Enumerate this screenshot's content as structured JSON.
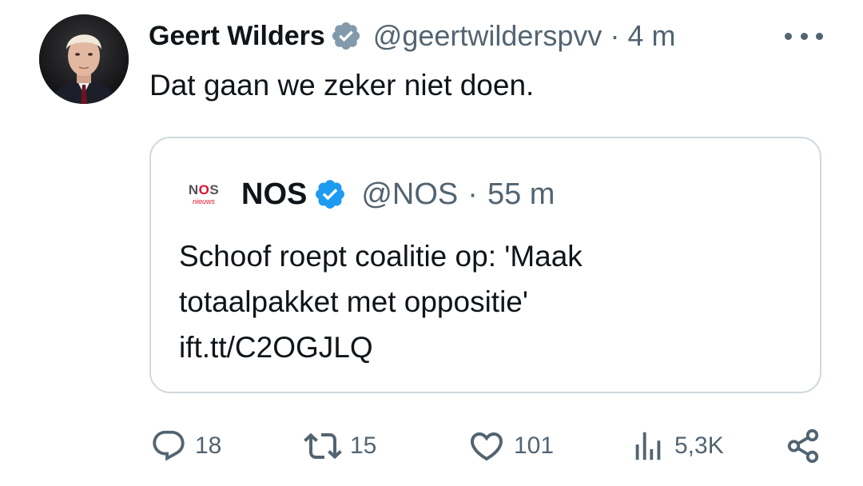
{
  "tweet": {
    "author": {
      "name": "Geert Wilders",
      "handle": "@geertwilderspvv",
      "verified_badge_color": "#829aab",
      "avatar_icon": "profile-photo"
    },
    "separator": "·",
    "time": "4 m",
    "more_icon": "ellipsis-icon",
    "text": "Dat gaan we zeker niet doen."
  },
  "quoted": {
    "logo_text": "NOS",
    "logo_subtext": "nieuws",
    "name": "NOS",
    "handle": "@NOS",
    "separator": "·",
    "time": "55 m",
    "verified_badge_color": "#1d9bf0",
    "text_lines": [
      "Schoof roept coalitie op: 'Maak",
      "totaalpakket met oppositie'",
      "ift.tt/C2OGJLQ"
    ]
  },
  "actions": {
    "replies": "18",
    "reposts": "15",
    "likes": "101",
    "views": "5,3K",
    "icons": [
      "reply-icon",
      "repost-icon",
      "like-icon",
      "views-icon",
      "share-icon"
    ],
    "icon_color": "#536471"
  }
}
